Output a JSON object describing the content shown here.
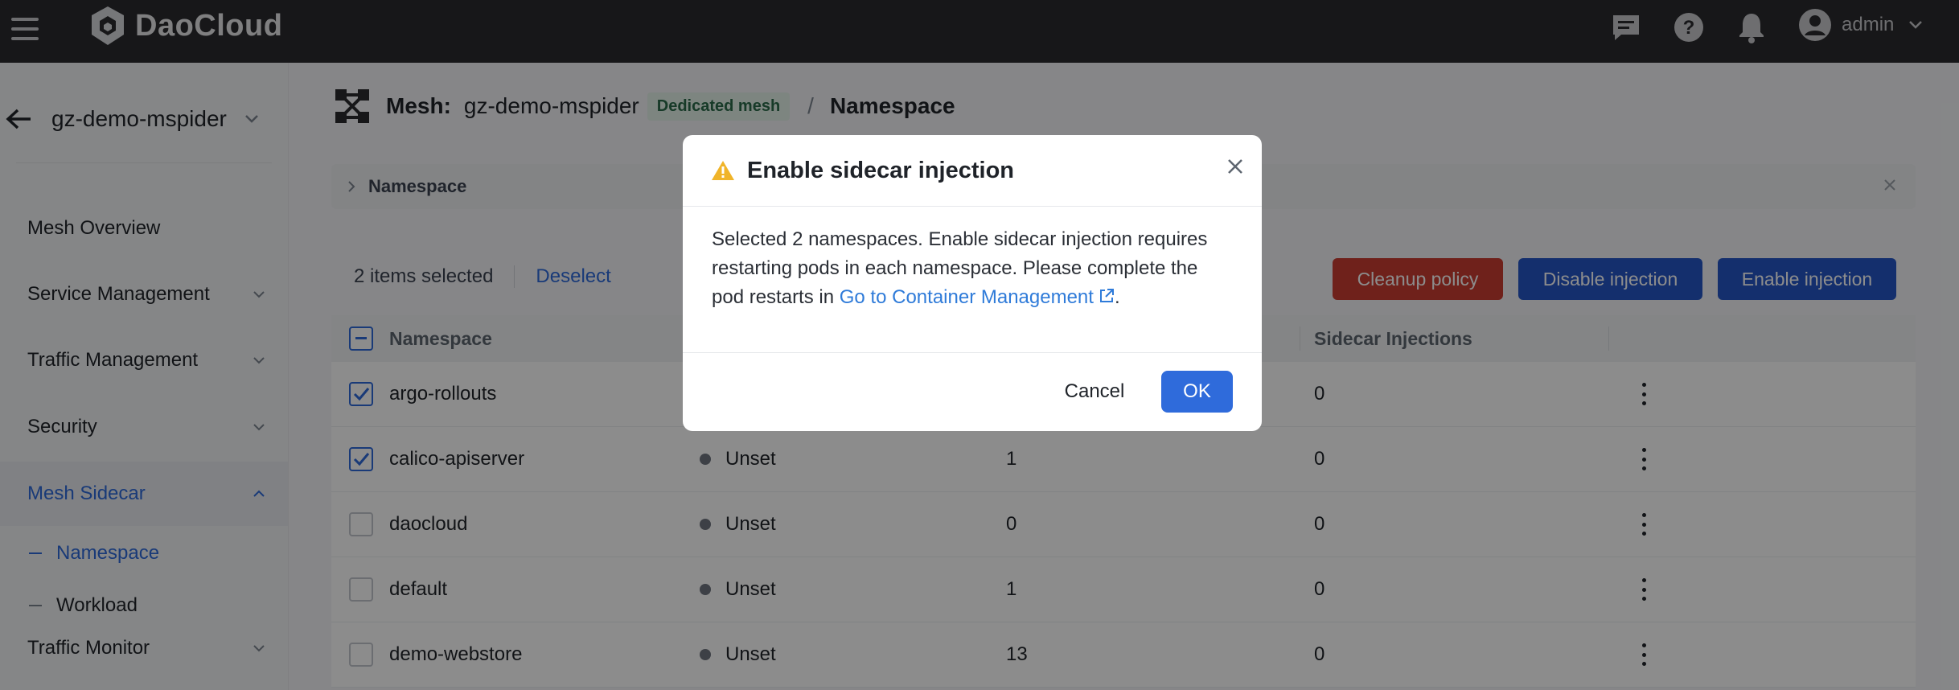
{
  "topbar": {
    "logo_text": "DaoCloud",
    "user_name": "admin"
  },
  "sidebar": {
    "mesh_name": "gz-demo-mspider",
    "items": [
      {
        "label": "Mesh Overview"
      },
      {
        "label": "Service Management"
      },
      {
        "label": "Traffic Management"
      },
      {
        "label": "Security"
      },
      {
        "label": "Mesh Sidecar"
      },
      {
        "label": "Traffic Monitor"
      }
    ],
    "sub_items": [
      {
        "label": "Namespace"
      },
      {
        "label": "Workload"
      }
    ]
  },
  "breadcrumb": {
    "prefix": "Mesh:",
    "mesh_name": "gz-demo-mspider",
    "badge": "Dedicated mesh",
    "separator": "/",
    "page": "Namespace"
  },
  "filter": {
    "label": "Namespace"
  },
  "actions": {
    "selected_count": "2 items selected",
    "deselect": "Deselect",
    "cleanup": "Cleanup policy",
    "disable": "Disable injection",
    "enable": "Enable injection"
  },
  "table": {
    "headers": {
      "namespace": "Namespace",
      "sidecar_injections": "Sidecar Injections"
    },
    "rows": [
      {
        "name": "argo-rollouts",
        "status": "",
        "pods": "",
        "injections": "0",
        "checked": true
      },
      {
        "name": "calico-apiserver",
        "status": "Unset",
        "pods": "1",
        "injections": "0",
        "checked": true
      },
      {
        "name": "daocloud",
        "status": "Unset",
        "pods": "0",
        "injections": "0",
        "checked": false
      },
      {
        "name": "default",
        "status": "Unset",
        "pods": "1",
        "injections": "0",
        "checked": false
      },
      {
        "name": "demo-webstore",
        "status": "Unset",
        "pods": "13",
        "injections": "0",
        "checked": false
      }
    ]
  },
  "modal": {
    "title": "Enable sidecar injection",
    "body_text": "Selected 2 namespaces. Enable sidecar injection requires restarting pods in each namespace. Please complete the pod restarts in ",
    "link_text": "Go to Container Management",
    "body_end": ".",
    "cancel": "Cancel",
    "ok": "OK"
  },
  "colors": {
    "accent": "#2f6bdb",
    "danger": "#ca3d32",
    "topbar": "#2a2b2e",
    "warning": "#f0b429",
    "badge_bg": "#e3f2ea"
  }
}
